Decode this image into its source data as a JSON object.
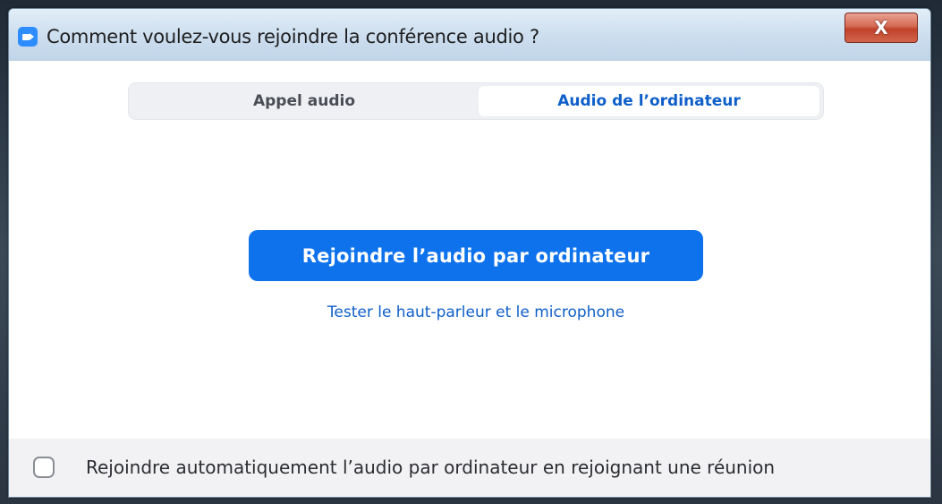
{
  "window": {
    "title": "Comment voulez-vous rejoindre la conférence audio ?",
    "close_label": "X"
  },
  "tabs": [
    {
      "label": "Appel audio",
      "selected": false
    },
    {
      "label": "Audio de l’ordinateur",
      "selected": true
    }
  ],
  "main": {
    "join_button_label": "Rejoindre l’audio par ordinateur",
    "test_link_label": "Tester le haut-parleur et le microphone"
  },
  "footer": {
    "auto_join_label": "Rejoindre automatiquement l’audio par ordinateur en rejoignant une réunion",
    "auto_join_checked": false
  },
  "icons": {
    "app": "zoom-camera-icon",
    "close": "close-icon"
  },
  "colors": {
    "accent": "#0E72ED",
    "link": "#0E5FC9",
    "close_button": "#C1412A"
  }
}
